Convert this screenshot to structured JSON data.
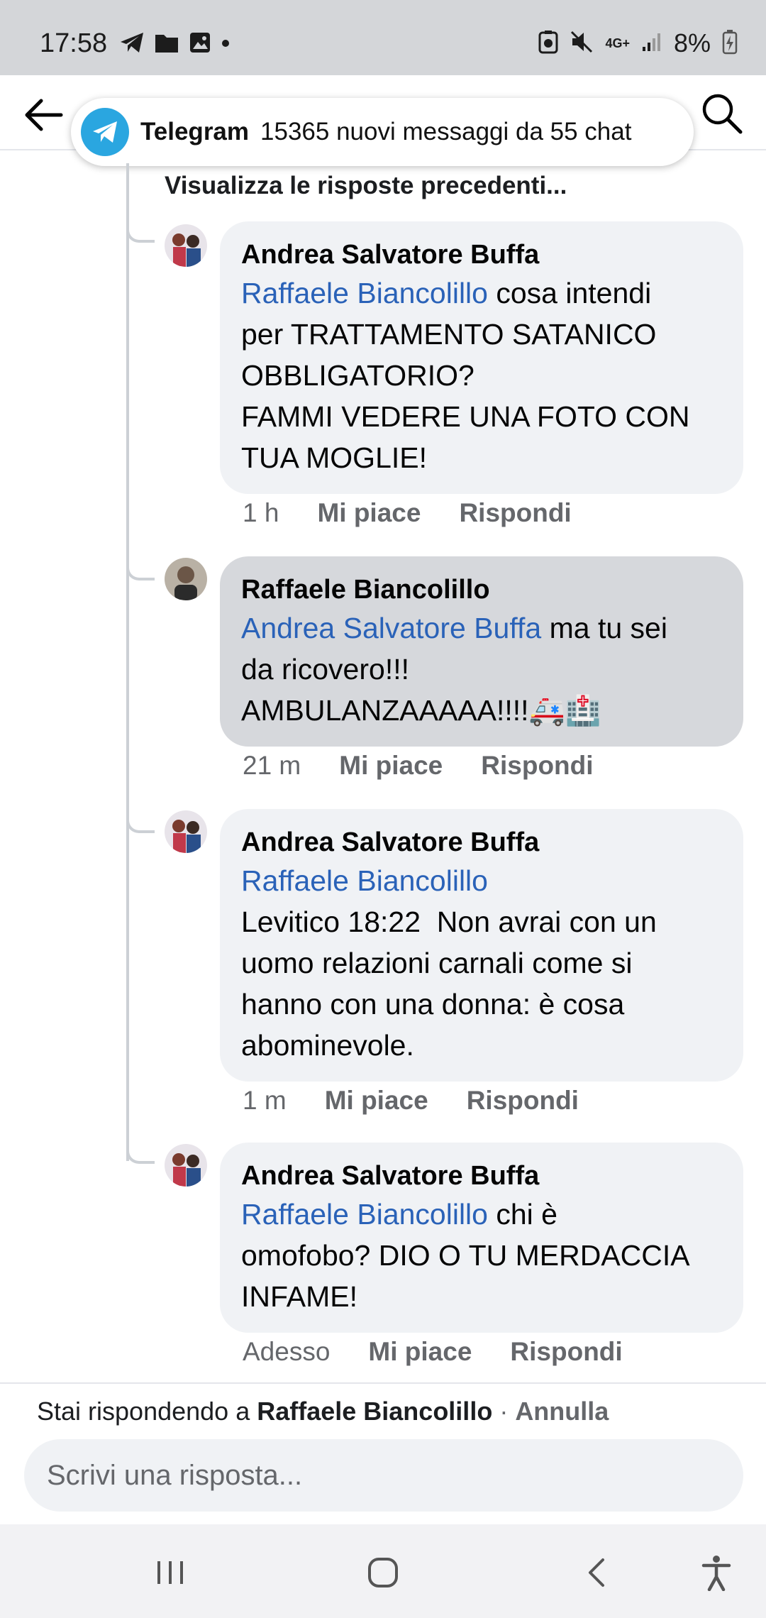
{
  "status_bar": {
    "time": "17:58",
    "network": "4G+",
    "battery": "8%"
  },
  "notification": {
    "app": "Telegram",
    "message": "15365 nuovi messaggi da 55 chat"
  },
  "thread": {
    "previous_replies_link": "Visualizza le risposte precedenti...",
    "comments": [
      {
        "author": "Andrea Salvatore Buffa",
        "mention": "Raffaele Biancolillo",
        "text": " cosa intendi\nper TRATTAMENTO SATANICO\nOBBLIGATORIO?\nFAMMI VEDERE UNA FOTO CON\nTUA MOGLIE!",
        "time": "1 h",
        "like": "Mi piace",
        "reply": "Rispondi"
      },
      {
        "author": "Raffaele Biancolillo",
        "mention": "Andrea Salvatore Buffa",
        "text": " ma tu sei\nda ricovero!!!\nAMBULANZAAAAA!!!!🚑🏥",
        "time": "21 m",
        "like": "Mi piace",
        "reply": "Rispondi"
      },
      {
        "author": "Andrea Salvatore Buffa",
        "mention": "Raffaele Biancolillo",
        "text": "\nLevitico 18:22  Non avrai con un\nuomo relazioni carnali come si\nhanno con una donna: è cosa\nabominevole.",
        "time": "1 m",
        "like": "Mi piace",
        "reply": "Rispondi"
      },
      {
        "author": "Andrea Salvatore Buffa",
        "mention": "Raffaele Biancolillo",
        "text": " chi è\nomofobo? DIO O TU MERDACCIA\nINFAME!",
        "time": "Adesso",
        "like": "Mi piace",
        "reply": "Rispondi"
      }
    ]
  },
  "reply_bar": {
    "prefix": "Stai rispondendo a ",
    "target": "Raffaele Biancolillo",
    "separator": " · ",
    "cancel": "Annulla",
    "placeholder": "Scrivi una risposta..."
  },
  "colors": {
    "mention": "#2a62b8",
    "bubble": "#f0f2f5",
    "bubble_selected": "#d6d8dc",
    "meta": "#65676b",
    "telegram": "#2aa6e0"
  }
}
